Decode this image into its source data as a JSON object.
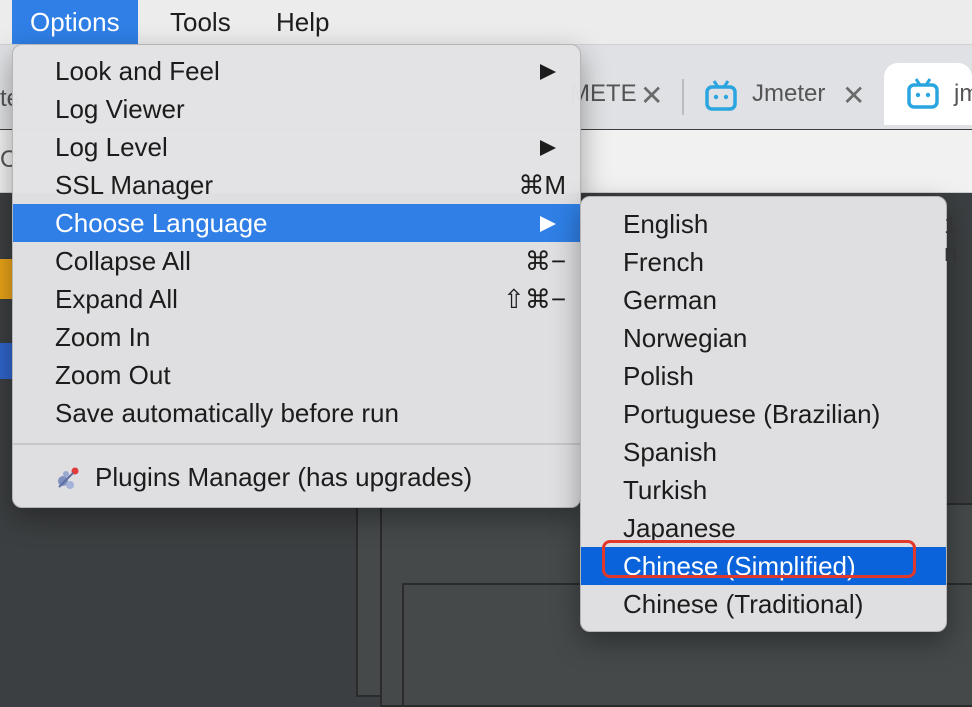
{
  "menubar": {
    "items": [
      {
        "label": "Options"
      },
      {
        "label": "Tools"
      },
      {
        "label": "Help"
      }
    ]
  },
  "browser": {
    "tab1_label": "METE",
    "tab2_label": "Jmeter",
    "tab3_label": "jm",
    "close_glyph": "✕"
  },
  "background_text": {
    "left_cut_top": "te",
    "left_cut_mid": "C",
    "right_cut": "1 n"
  },
  "options_menu": {
    "items": [
      {
        "label": "Look and Feel",
        "shortcut": "",
        "submenu": true
      },
      {
        "label": "Log Viewer",
        "shortcut": "",
        "submenu": false
      },
      {
        "label": "Log Level",
        "shortcut": "",
        "submenu": true
      },
      {
        "label": "SSL Manager",
        "shortcut": "⌘M",
        "submenu": false
      },
      {
        "label": "Choose Language",
        "shortcut": "",
        "submenu": true,
        "highlighted": true
      },
      {
        "label": "Collapse All",
        "shortcut": "⌘−",
        "submenu": false
      },
      {
        "label": "Expand All",
        "shortcut": "⇧⌘−",
        "submenu": false
      },
      {
        "label": "Zoom In",
        "shortcut": "",
        "submenu": false
      },
      {
        "label": "Zoom Out",
        "shortcut": "",
        "submenu": false
      },
      {
        "label": "Save automatically before run",
        "shortcut": "",
        "submenu": false
      }
    ],
    "plugins_label": "Plugins Manager (has upgrades)"
  },
  "language_menu": {
    "items": [
      {
        "label": "English"
      },
      {
        "label": "French"
      },
      {
        "label": "German"
      },
      {
        "label": "Norwegian"
      },
      {
        "label": "Polish"
      },
      {
        "label": "Portuguese (Brazilian)"
      },
      {
        "label": "Spanish"
      },
      {
        "label": "Turkish"
      },
      {
        "label": "Japanese"
      },
      {
        "label": "Chinese (Simplified)",
        "highlighted": true
      },
      {
        "label": "Chinese (Traditional)"
      }
    ]
  },
  "colors": {
    "menu_highlight": "#2f7fe6",
    "submenu_highlight": "#0b63db",
    "annotation_box": "#e0392b"
  }
}
